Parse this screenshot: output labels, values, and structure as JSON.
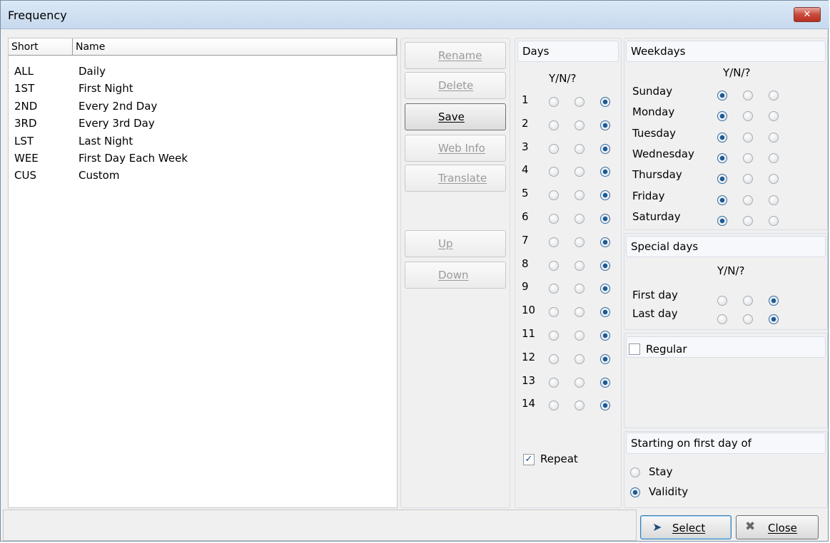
{
  "window": {
    "title": "Frequency",
    "close_glyph": "✕"
  },
  "list": {
    "columns": [
      "Short",
      "Name"
    ],
    "rows": [
      {
        "short": "ALL",
        "name": "Daily"
      },
      {
        "short": "1ST",
        "name": "First Night"
      },
      {
        "short": "2ND",
        "name": "Every 2nd Day"
      },
      {
        "short": "3RD",
        "name": "Every 3rd Day"
      },
      {
        "short": "LST",
        "name": "Last Night"
      },
      {
        "short": "WEE",
        "name": "First Day Each Week"
      },
      {
        "short": "CUS",
        "name": "Custom"
      }
    ]
  },
  "actions": [
    {
      "id": "rename",
      "label": "Rename",
      "icon": "rename-icon",
      "enabled": false
    },
    {
      "id": "delete",
      "label": "Delete",
      "icon": "trash-icon",
      "enabled": false
    },
    {
      "id": "save",
      "label": "Save",
      "icon": "floppy-disk-icon",
      "enabled": true
    },
    {
      "id": "web-info",
      "label": "Web Info",
      "icon": "globe-icon",
      "enabled": false
    },
    {
      "id": "translate",
      "label": "Translate",
      "icon": "translate-icon",
      "enabled": false
    },
    {
      "id": "up",
      "label": "Up",
      "icon": "arrow-up-icon",
      "enabled": false
    },
    {
      "id": "down",
      "label": "Down",
      "icon": "arrow-down-icon",
      "enabled": false
    }
  ],
  "days": {
    "title": "Days",
    "header": "Y/N/?",
    "items": [
      {
        "n": "1",
        "value": "?"
      },
      {
        "n": "2",
        "value": "?"
      },
      {
        "n": "3",
        "value": "?"
      },
      {
        "n": "4",
        "value": "?"
      },
      {
        "n": "5",
        "value": "?"
      },
      {
        "n": "6",
        "value": "?"
      },
      {
        "n": "7",
        "value": "?"
      },
      {
        "n": "8",
        "value": "?"
      },
      {
        "n": "9",
        "value": "?"
      },
      {
        "n": "10",
        "value": "?"
      },
      {
        "n": "11",
        "value": "?"
      },
      {
        "n": "12",
        "value": "?"
      },
      {
        "n": "13",
        "value": "?"
      },
      {
        "n": "14",
        "value": "?"
      }
    ],
    "repeat": {
      "label": "Repeat",
      "checked": true
    }
  },
  "weekdays": {
    "title": "Weekdays",
    "header": "Y/N/?",
    "items": [
      {
        "name": "Sunday",
        "value": "Y"
      },
      {
        "name": "Monday",
        "value": "Y"
      },
      {
        "name": "Tuesday",
        "value": "Y"
      },
      {
        "name": "Wednesday",
        "value": "Y"
      },
      {
        "name": "Thursday",
        "value": "Y"
      },
      {
        "name": "Friday",
        "value": "Y"
      },
      {
        "name": "Saturday",
        "value": "Y"
      }
    ]
  },
  "special_days": {
    "title": "Special days",
    "header": "Y/N/?",
    "items": [
      {
        "name": "First day",
        "value": "?"
      },
      {
        "name": "Last day",
        "value": "?"
      }
    ]
  },
  "regular": {
    "label": "Regular",
    "checked": false
  },
  "starting": {
    "title": "Starting on first day of",
    "options": [
      {
        "label": "Stay",
        "selected": false
      },
      {
        "label": "Validity",
        "selected": true
      }
    ]
  },
  "footer": {
    "select_label": "Select",
    "close_label": "Close"
  },
  "colors": {
    "selected_radio": "#1f5a93",
    "title_bar": "#c7d9ee",
    "close_button": "#c9493c"
  }
}
